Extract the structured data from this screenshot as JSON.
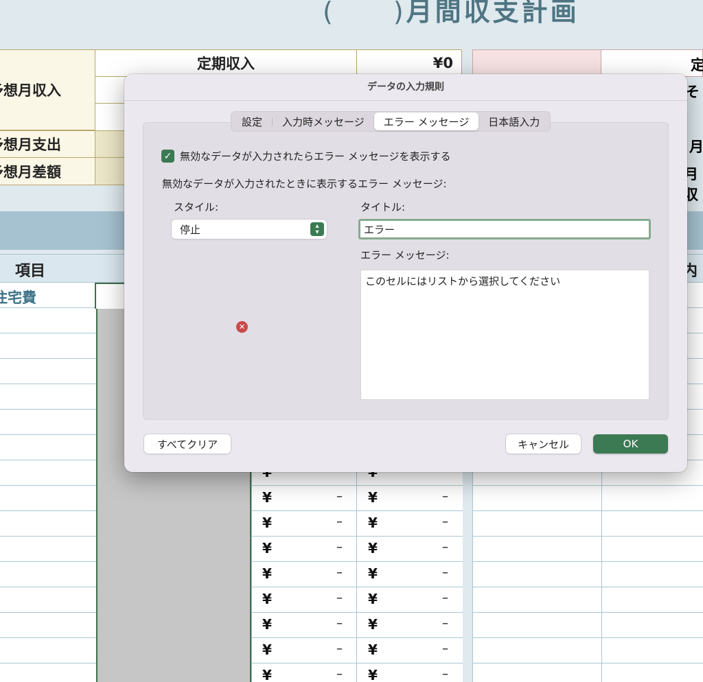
{
  "sheet": {
    "title_parens": "(　　)",
    "title_text": "月間収支計画",
    "income_label": "予想月収入",
    "expense_label": "予想月支出",
    "diff_label": "予想月差額",
    "fixed_income_label": "定期収入",
    "fixed_income_value": "¥0",
    "column_item_header": "項目",
    "column_right_header": "内訳",
    "category_label": "住宅費",
    "right_labels": [
      "定",
      "そ",
      "月",
      "月",
      "月収"
    ],
    "yen_symbol": "¥",
    "dash_symbol": "–"
  },
  "dialog": {
    "title": "データの入力規則",
    "tabs": [
      "設定",
      "入力時メッセージ",
      "エラー メッセージ",
      "日本語入力"
    ],
    "active_tab": "エラー メッセージ",
    "show_error_checkbox": {
      "checked": true,
      "label": "無効なデータが入力されたらエラー メッセージを表示する"
    },
    "section_label": "無効なデータが入力されたときに表示するエラー メッセージ:",
    "style_label": "スタイル:",
    "style_value": "停止",
    "title_label": "タイトル:",
    "title_value": "エラー",
    "message_label": "エラー メッセージ:",
    "message_value": "このセルにはリストから選択してください",
    "clear_all_button": "すべてクリア",
    "cancel_button": "キャンセル",
    "ok_button": "OK",
    "accent_color": "#3b7a53",
    "style_icon": "stop-error-icon"
  }
}
